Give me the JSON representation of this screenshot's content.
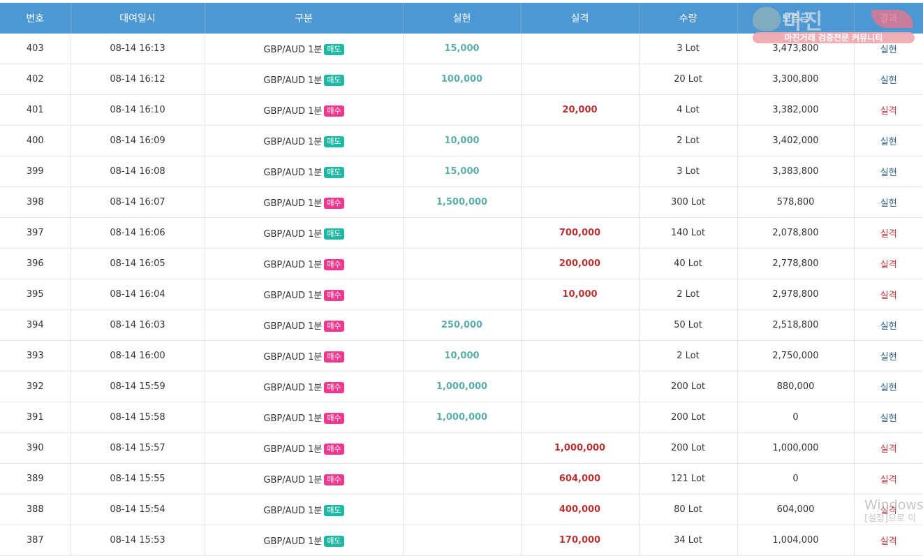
{
  "columns": [
    "번호",
    "대여일시",
    "구분",
    "실현",
    "실격",
    "수량",
    "보증금",
    "결과"
  ],
  "colors": {
    "header": "#4d97d3",
    "sell_badge": "#1fb8a3",
    "buy_badge": "#ee3a8c",
    "profit": "#5aaeaa",
    "loss": "#b73333",
    "result_win": "#2d5f86",
    "result_lose": "#c0343b"
  },
  "rows": [
    {
      "no": "403",
      "datetime": "08-14 16:13",
      "product": "GBP/AUD 1분",
      "side": "매도",
      "profit": "15,000",
      "loss": "",
      "qty": "3 Lot",
      "deposit": "3,473,800",
      "result": "실현"
    },
    {
      "no": "402",
      "datetime": "08-14 16:12",
      "product": "GBP/AUD 1분",
      "side": "매도",
      "profit": "100,000",
      "loss": "",
      "qty": "20 Lot",
      "deposit": "3,300,800",
      "result": "실현"
    },
    {
      "no": "401",
      "datetime": "08-14 16:10",
      "product": "GBP/AUD 1분",
      "side": "매수",
      "profit": "",
      "loss": "20,000",
      "qty": "4 Lot",
      "deposit": "3,382,000",
      "result": "실격"
    },
    {
      "no": "400",
      "datetime": "08-14 16:09",
      "product": "GBP/AUD 1분",
      "side": "매도",
      "profit": "10,000",
      "loss": "",
      "qty": "2 Lot",
      "deposit": "3,402,000",
      "result": "실현"
    },
    {
      "no": "399",
      "datetime": "08-14 16:08",
      "product": "GBP/AUD 1분",
      "side": "매도",
      "profit": "15,000",
      "loss": "",
      "qty": "3 Lot",
      "deposit": "3,383,800",
      "result": "실현"
    },
    {
      "no": "398",
      "datetime": "08-14 16:07",
      "product": "GBP/AUD 1분",
      "side": "매수",
      "profit": "1,500,000",
      "loss": "",
      "qty": "300 Lot",
      "deposit": "578,800",
      "result": "실현"
    },
    {
      "no": "397",
      "datetime": "08-14 16:06",
      "product": "GBP/AUD 1분",
      "side": "매도",
      "profit": "",
      "loss": "700,000",
      "qty": "140 Lot",
      "deposit": "2,078,800",
      "result": "실격"
    },
    {
      "no": "396",
      "datetime": "08-14 16:05",
      "product": "GBP/AUD 1분",
      "side": "매수",
      "profit": "",
      "loss": "200,000",
      "qty": "40 Lot",
      "deposit": "2,778,800",
      "result": "실격"
    },
    {
      "no": "395",
      "datetime": "08-14 16:04",
      "product": "GBP/AUD 1분",
      "side": "매수",
      "profit": "",
      "loss": "10,000",
      "qty": "2 Lot",
      "deposit": "2,978,800",
      "result": "실격"
    },
    {
      "no": "394",
      "datetime": "08-14 16:03",
      "product": "GBP/AUD 1분",
      "side": "매수",
      "profit": "250,000",
      "loss": "",
      "qty": "50 Lot",
      "deposit": "2,518,800",
      "result": "실현"
    },
    {
      "no": "393",
      "datetime": "08-14 16:00",
      "product": "GBP/AUD 1분",
      "side": "매수",
      "profit": "10,000",
      "loss": "",
      "qty": "2 Lot",
      "deposit": "2,750,000",
      "result": "실현"
    },
    {
      "no": "392",
      "datetime": "08-14 15:59",
      "product": "GBP/AUD 1분",
      "side": "매수",
      "profit": "1,000,000",
      "loss": "",
      "qty": "200 Lot",
      "deposit": "880,000",
      "result": "실현"
    },
    {
      "no": "391",
      "datetime": "08-14 15:58",
      "product": "GBP/AUD 1분",
      "side": "매수",
      "profit": "1,000,000",
      "loss": "",
      "qty": "200 Lot",
      "deposit": "0",
      "result": "실현"
    },
    {
      "no": "390",
      "datetime": "08-14 15:57",
      "product": "GBP/AUD 1분",
      "side": "매수",
      "profit": "",
      "loss": "1,000,000",
      "qty": "200 Lot",
      "deposit": "1,000,000",
      "result": "실격"
    },
    {
      "no": "389",
      "datetime": "08-14 15:55",
      "product": "GBP/AUD 1분",
      "side": "매수",
      "profit": "",
      "loss": "604,000",
      "qty": "121 Lot",
      "deposit": "0",
      "result": "실격"
    },
    {
      "no": "388",
      "datetime": "08-14 15:54",
      "product": "GBP/AUD 1분",
      "side": "매도",
      "profit": "",
      "loss": "400,000",
      "qty": "80 Lot",
      "deposit": "604,000",
      "result": "실격"
    },
    {
      "no": "387",
      "datetime": "08-14 15:53",
      "product": "GBP/AUD 1분",
      "side": "매도",
      "profit": "",
      "loss": "170,000",
      "qty": "34 Lot",
      "deposit": "1,004,000",
      "result": "실격"
    }
  ],
  "watermark": {
    "logo_text": "마진",
    "logo_sub": "마진거래 검증전문 커뮤니티"
  },
  "os_watermark": {
    "line1": "Windows",
    "line2": "[설정]으로 이"
  }
}
